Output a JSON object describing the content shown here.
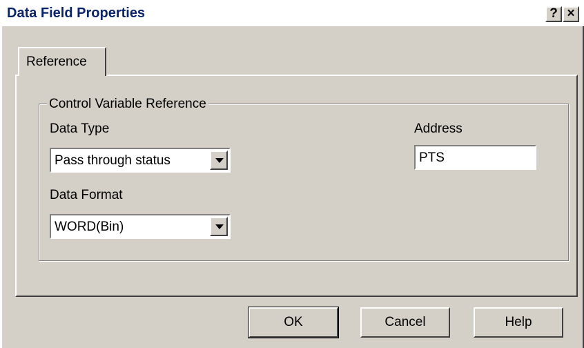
{
  "window": {
    "title": "Data Field Properties",
    "help_btn": "?",
    "close_btn": "×"
  },
  "tabs": [
    {
      "label": "Reference",
      "active": true
    }
  ],
  "group": {
    "label": "Control Variable Reference"
  },
  "fields": {
    "data_type": {
      "label": "Data Type",
      "value": "Pass through status"
    },
    "data_format": {
      "label": "Data Format",
      "value": "WORD(Bin)"
    },
    "address": {
      "label": "Address",
      "value": "PTS"
    }
  },
  "buttons": {
    "ok": "OK",
    "cancel": "Cancel",
    "help": "Help"
  }
}
